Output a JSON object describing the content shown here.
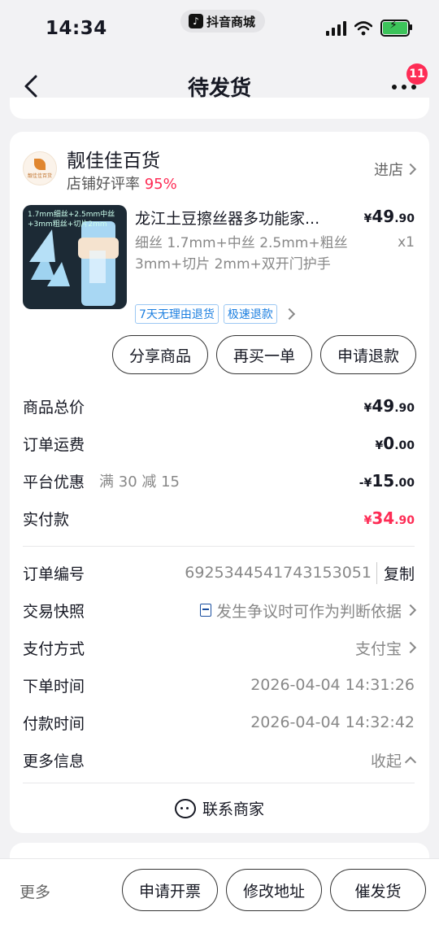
{
  "status_bar": {
    "time": "14:34",
    "app_pill": "抖音商城",
    "tk_icon": "♪"
  },
  "nav": {
    "title": "待发货",
    "badge": "11"
  },
  "shop": {
    "name": "靓佳佳百货",
    "rating_label": "店铺好评率",
    "rating_value": "95%",
    "enter_label": "进店",
    "logo_text": "靓佳佳百货"
  },
  "product": {
    "thumb_caption": "1.7mm细丝+2.5mm中丝+3mm粗丝+切片2mm",
    "title": "龙江土豆擦丝器多功能家...",
    "spec": "细丝 1.7mm+中丝 2.5mm+粗丝 3mm+切片 2mm+双开门护手",
    "price_currency": "¥",
    "price_int": "49",
    "price_dec": ".90",
    "qty": "x1",
    "tags": [
      "7天无理由退货",
      "极速退款"
    ]
  },
  "actions": {
    "share": "分享商品",
    "rebuy": "再买一单",
    "refund": "申请退款"
  },
  "summary": {
    "total_label": "商品总价",
    "total_cur": "¥",
    "total_int": "49",
    "total_dec": ".90",
    "shipping_label": "订单运费",
    "shipping_cur": "¥",
    "shipping_int": "0",
    "shipping_dec": ".00",
    "discount_label": "平台优惠",
    "discount_sub": "满 30 减 15",
    "discount_cur": "-¥",
    "discount_int": "15",
    "discount_dec": ".00",
    "paid_label": "实付款",
    "paid_cur": "¥",
    "paid_int": "34",
    "paid_dec": ".90"
  },
  "info": {
    "order_no_label": "订单编号",
    "order_no": "6925344541743153051",
    "copy_label": "复制",
    "snapshot_label": "交易快照",
    "snapshot_link": "发生争议时可作为判断依据",
    "pay_method_label": "支付方式",
    "pay_method": "支付宝",
    "order_time_label": "下单时间",
    "order_time": "2026-04-04 14:31:26",
    "pay_time_label": "付款时间",
    "pay_time": "2026-04-04 14:32:42",
    "more_info_label": "更多信息",
    "collapse_label": "收起"
  },
  "contact_label": "联系商家",
  "bottom": {
    "more": "更多",
    "invoice": "申请开票",
    "edit_address": "修改地址",
    "urge": "催发货"
  },
  "colors": {
    "accent": "#fe2c55",
    "link": "#1a4fa0",
    "tag_blue": "#1c7fe0"
  }
}
